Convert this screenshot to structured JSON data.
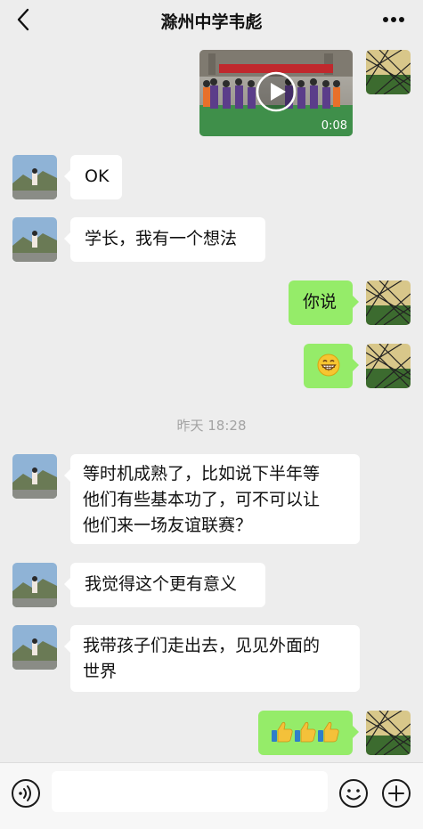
{
  "header": {
    "back_icon": "chevron-left-icon",
    "title": "滁州中学韦彪",
    "more_icon": "ellipsis-icon"
  },
  "messages": {
    "m1": {
      "type": "video",
      "side": "right",
      "duration": "0:08"
    },
    "m2": {
      "side": "left",
      "text": "OK"
    },
    "m3": {
      "side": "left",
      "text": "学长，我有一个想法"
    },
    "m4": {
      "side": "right",
      "text": "你说"
    },
    "m5": {
      "side": "right",
      "emoji": "grinning-face-emoji"
    },
    "timestamp": "昨天 18:28",
    "m6": {
      "side": "left",
      "lines": [
        "等时机成熟了，比如说下半年等",
        "他们有些基本功了，可不可以让",
        "他们来一场友谊联赛？"
      ]
    },
    "m7": {
      "side": "left",
      "text": "我觉得这个更有意义"
    },
    "m8": {
      "side": "left",
      "lines": [
        "我带孩子们走出去，见见外面的",
        "世界"
      ]
    },
    "m9": {
      "side": "right",
      "emoji": "thumbs-up-emoji",
      "count": 3
    }
  },
  "input_bar": {
    "voice_icon": "voice-icon",
    "placeholder": "",
    "emoji_icon": "emoji-icon",
    "plus_icon": "plus-icon"
  },
  "colors": {
    "background": "#ededed",
    "outgoing_bubble": "#95ec69",
    "incoming_bubble": "#ffffff",
    "timestamp": "#a3a3a3"
  }
}
